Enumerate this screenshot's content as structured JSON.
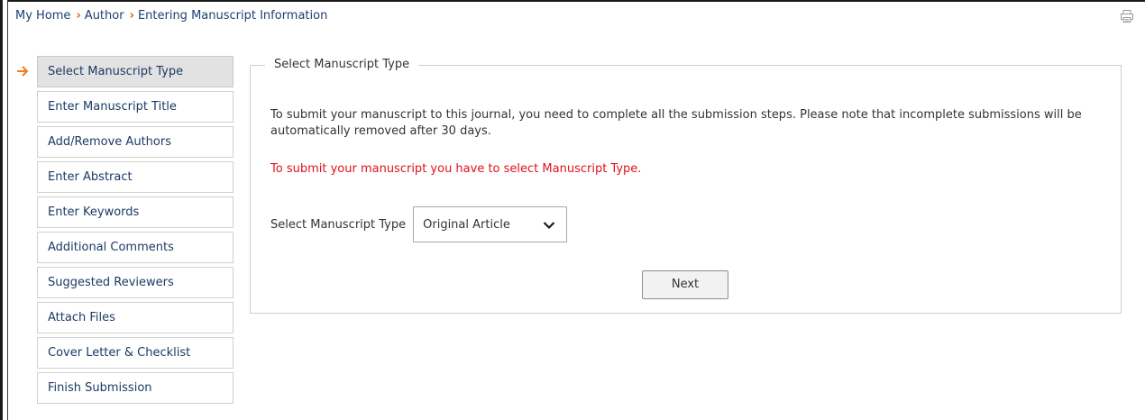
{
  "breadcrumb": {
    "items": [
      "My Home",
      "Author"
    ],
    "current": "Entering Manuscript Information",
    "separator_icon": "chevron-right-icon",
    "separator_color": "#e0551d"
  },
  "toolbar": {
    "print_icon": "printer-icon"
  },
  "nav": {
    "active_index": 0,
    "active_indicator_icon": "arrow-right-icon",
    "accent_color": "#f07d1f",
    "items": [
      {
        "label": "Select Manuscript Type"
      },
      {
        "label": "Enter Manuscript Title"
      },
      {
        "label": "Add/Remove Authors"
      },
      {
        "label": "Enter Abstract"
      },
      {
        "label": "Enter Keywords"
      },
      {
        "label": "Additional Comments"
      },
      {
        "label": "Suggested Reviewers"
      },
      {
        "label": "Attach Files"
      },
      {
        "label": "Cover Letter & Checklist"
      },
      {
        "label": "Finish Submission"
      }
    ]
  },
  "panel": {
    "legend": "Select Manuscript Type",
    "intro": "To submit your manuscript to this journal, you need to complete all the submission steps. Please note that incomplete submissions will be automatically removed after 30 days.",
    "warning": "To submit your manuscript you have to select Manuscript Type.",
    "warning_color": "#e0121b",
    "field_label": "Select Manuscript Type",
    "select_value": "Original Article",
    "select_icon": "chevron-down-icon",
    "next_label": "Next"
  }
}
